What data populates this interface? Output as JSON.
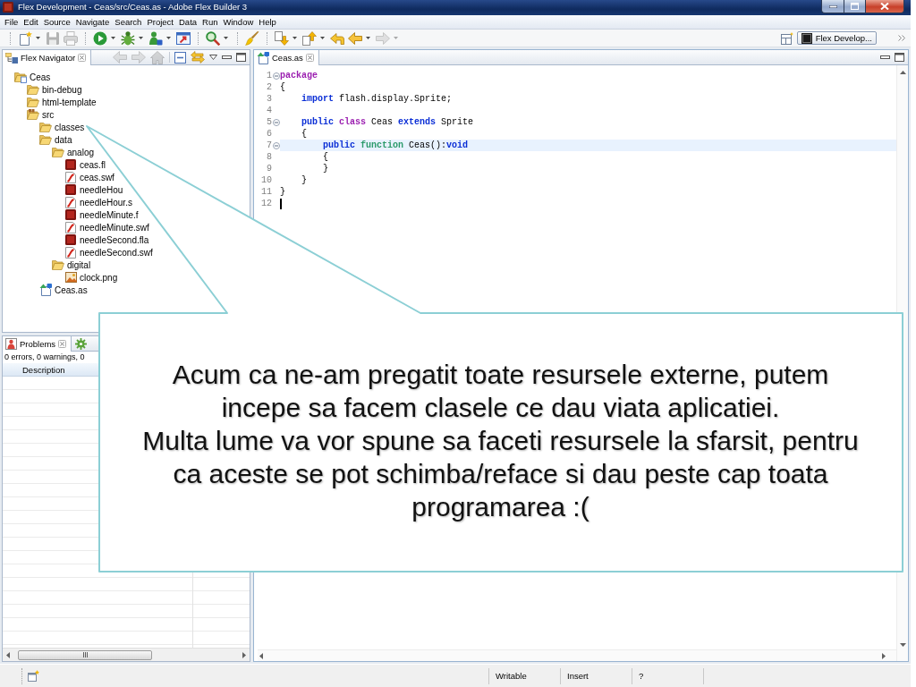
{
  "window": {
    "title": "Flex Development - Ceas/src/Ceas.as - Adobe Flex Builder 3"
  },
  "menu": [
    "File",
    "Edit",
    "Source",
    "Navigate",
    "Search",
    "Project",
    "Data",
    "Run",
    "Window",
    "Help"
  ],
  "toolbar": [
    {
      "kind": "new",
      "disabled": false,
      "dropdown": true
    },
    {
      "kind": "save",
      "disabled": true,
      "dropdown": false
    },
    {
      "kind": "print",
      "disabled": true,
      "dropdown": false
    },
    {
      "kind": "separator"
    },
    {
      "kind": "run",
      "disabled": false,
      "dropdown": true
    },
    {
      "kind": "debug",
      "disabled": false,
      "dropdown": true
    },
    {
      "kind": "profile",
      "disabled": false,
      "dropdown": true
    },
    {
      "kind": "export",
      "disabled": false,
      "dropdown": false
    },
    {
      "kind": "separator"
    },
    {
      "kind": "search",
      "disabled": false,
      "dropdown": true
    },
    {
      "kind": "separator"
    },
    {
      "kind": "brush",
      "disabled": false,
      "dropdown": false
    },
    {
      "kind": "separator"
    },
    {
      "kind": "next-annotation",
      "disabled": false,
      "dropdown": true
    },
    {
      "kind": "previous-annotation",
      "disabled": false,
      "dropdown": true
    },
    {
      "kind": "last-edit",
      "disabled": false,
      "dropdown": false
    },
    {
      "kind": "back",
      "disabled": false,
      "dropdown": true
    },
    {
      "kind": "forward",
      "disabled": true,
      "dropdown": true
    }
  ],
  "perspective": {
    "label": "Flex Develop...",
    "selected": true
  },
  "navigator": {
    "tab": {
      "label": "Flex Navigator",
      "selected": true
    },
    "tools": [
      {
        "kind": "back",
        "disabled": true
      },
      {
        "kind": "forward",
        "disabled": true
      },
      {
        "kind": "home",
        "disabled": true
      },
      {
        "kind": "separator"
      },
      {
        "kind": "collapse-all",
        "disabled": false
      },
      {
        "kind": "link",
        "disabled": false
      },
      {
        "kind": "view-menu",
        "disabled": false
      },
      {
        "kind": "minimize",
        "disabled": false
      },
      {
        "kind": "maximize",
        "disabled": false
      }
    ],
    "tree": [
      {
        "name": "Ceas",
        "kind": "project",
        "children": [
          {
            "name": "bin-debug",
            "kind": "folder"
          },
          {
            "name": "html-template",
            "kind": "folder"
          },
          {
            "name": "src",
            "kind": "source-folder",
            "children": [
              {
                "name": "classes",
                "kind": "folder"
              },
              {
                "name": "data",
                "kind": "folder",
                "children": [
                  {
                    "name": "analog",
                    "kind": "folder",
                    "children": [
                      {
                        "name": "ceas.fl",
                        "kind": "fla"
                      },
                      {
                        "name": "ceas.swf",
                        "kind": "swf"
                      },
                      {
                        "name": "needleHou",
                        "kind": "fla"
                      },
                      {
                        "name": "needleHour.s",
                        "kind": "swf"
                      },
                      {
                        "name": "needleMinute.f",
                        "kind": "fla"
                      },
                      {
                        "name": "needleMinute.swf",
                        "kind": "swf"
                      },
                      {
                        "name": "needleSecond.fla",
                        "kind": "fla"
                      },
                      {
                        "name": "needleSecond.swf",
                        "kind": "swf"
                      }
                    ]
                  },
                  {
                    "name": "digital",
                    "kind": "folder",
                    "children": [
                      {
                        "name": "clock.png",
                        "kind": "image"
                      }
                    ]
                  }
                ]
              },
              {
                "name": "Ceas.as",
                "kind": "actionscript"
              }
            ]
          }
        ]
      }
    ]
  },
  "editor": {
    "tab": {
      "label": "Ceas.as",
      "selected": true
    },
    "tools": [
      {
        "kind": "minimize",
        "disabled": false
      },
      {
        "kind": "maximize",
        "disabled": false
      }
    ],
    "lines": [
      {
        "number": "1",
        "fold": true,
        "highlighted": false,
        "cursor": false,
        "tokens": [
          {
            "kind": "declaration",
            "text": "package"
          }
        ]
      },
      {
        "number": "2",
        "fold": false,
        "highlighted": false,
        "cursor": false,
        "tokens": [
          {
            "kind": "plain",
            "text": "{"
          }
        ]
      },
      {
        "number": "3",
        "fold": false,
        "highlighted": false,
        "cursor": false,
        "tokens": [
          {
            "kind": "keyword",
            "text": "    import"
          },
          {
            "kind": "plain",
            "text": " flash.display.Sprite;"
          }
        ]
      },
      {
        "number": "4",
        "fold": false,
        "highlighted": false,
        "cursor": false
      },
      {
        "number": "5",
        "fold": true,
        "highlighted": false,
        "cursor": false,
        "tokens": [
          {
            "kind": "keyword",
            "text": "    public"
          },
          {
            "kind": "declaration",
            "text": " class"
          },
          {
            "kind": "plain",
            "text": " Ceas "
          },
          {
            "kind": "keyword",
            "text": "extends"
          },
          {
            "kind": "plain",
            "text": " Sprite"
          }
        ]
      },
      {
        "number": "6",
        "fold": false,
        "highlighted": false,
        "cursor": false,
        "tokens": [
          {
            "kind": "plain",
            "text": "    {"
          }
        ]
      },
      {
        "number": "7",
        "fold": true,
        "highlighted": true,
        "cursor": false,
        "tokens": [
          {
            "kind": "keyword",
            "text": "        public"
          },
          {
            "kind": "function-keyword",
            "text": " function"
          },
          {
            "kind": "plain",
            "text": " Ceas():"
          },
          {
            "kind": "keyword",
            "text": "void"
          }
        ]
      },
      {
        "number": "8",
        "fold": false,
        "highlighted": false,
        "cursor": false,
        "tokens": [
          {
            "kind": "plain",
            "text": "        {"
          }
        ]
      },
      {
        "number": "9",
        "fold": false,
        "highlighted": false,
        "cursor": false,
        "tokens": [
          {
            "kind": "plain",
            "text": "        }"
          }
        ]
      },
      {
        "number": "10",
        "fold": false,
        "highlighted": false,
        "cursor": false,
        "tokens": [
          {
            "kind": "plain",
            "text": "    }"
          }
        ]
      },
      {
        "number": "11",
        "fold": false,
        "highlighted": false,
        "cursor": false,
        "tokens": [
          {
            "kind": "plain",
            "text": "}"
          }
        ]
      },
      {
        "number": "12",
        "fold": false,
        "highlighted": false,
        "cursor": true
      }
    ]
  },
  "problems": {
    "tab": {
      "label": "Problems",
      "selected": true
    },
    "summary": "0 errors, 0 warnings, 0",
    "columns": [
      "Description"
    ]
  },
  "status_bar": {
    "fields": [
      "Writable",
      "Insert",
      "?"
    ]
  },
  "callout": {
    "paragraphs": [
      "Acum ca ne-am pregatit toate resursele externe, putem incepe sa facem clasele ce dau viata aplicatiei.",
      "Multa lume va vor spune sa faceti resursele la sfarsit, pentru ca aceste se pot schimba/reface si dau peste cap toata programarea :("
    ]
  }
}
